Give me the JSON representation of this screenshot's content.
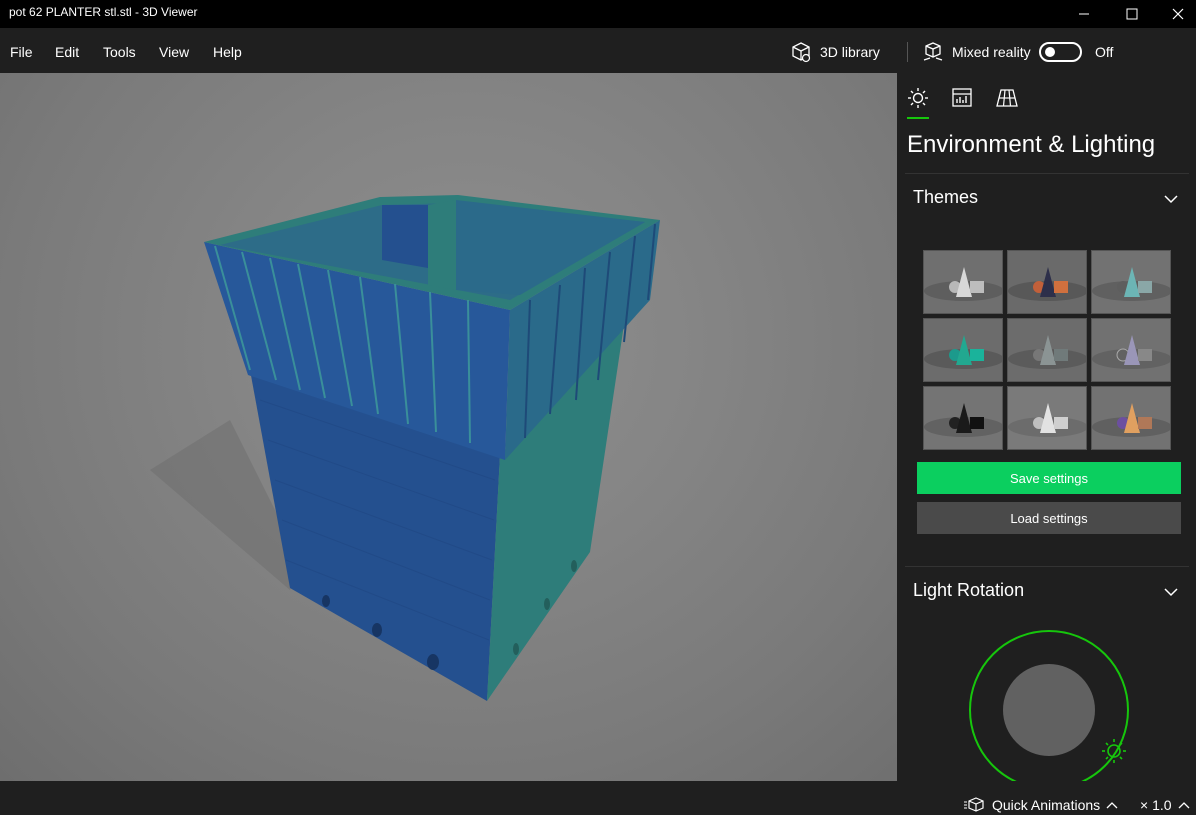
{
  "window": {
    "title": "pot 62 PLANTER stl.stl - 3D Viewer"
  },
  "menu": {
    "items": [
      "File",
      "Edit",
      "Tools",
      "View",
      "Help"
    ]
  },
  "toolbar": {
    "library_label": "3D library",
    "mixed_reality_label": "Mixed reality",
    "toggle_state": "Off"
  },
  "panel": {
    "tabs": [
      "sun-icon",
      "stats-icon",
      "grid-icon"
    ],
    "title": "Environment & Lighting",
    "themes_label": "Themes",
    "save_label": "Save settings",
    "load_label": "Load settings",
    "light_rotation_label": "Light Rotation"
  },
  "status": {
    "quick_animations_label": "Quick Animations",
    "zoom_label": "× 1.0"
  },
  "colors": {
    "accent": "#16c60c",
    "save_button": "#0bcf5f",
    "model_blue": "#24508f",
    "model_teal": "#2e7d7a"
  }
}
